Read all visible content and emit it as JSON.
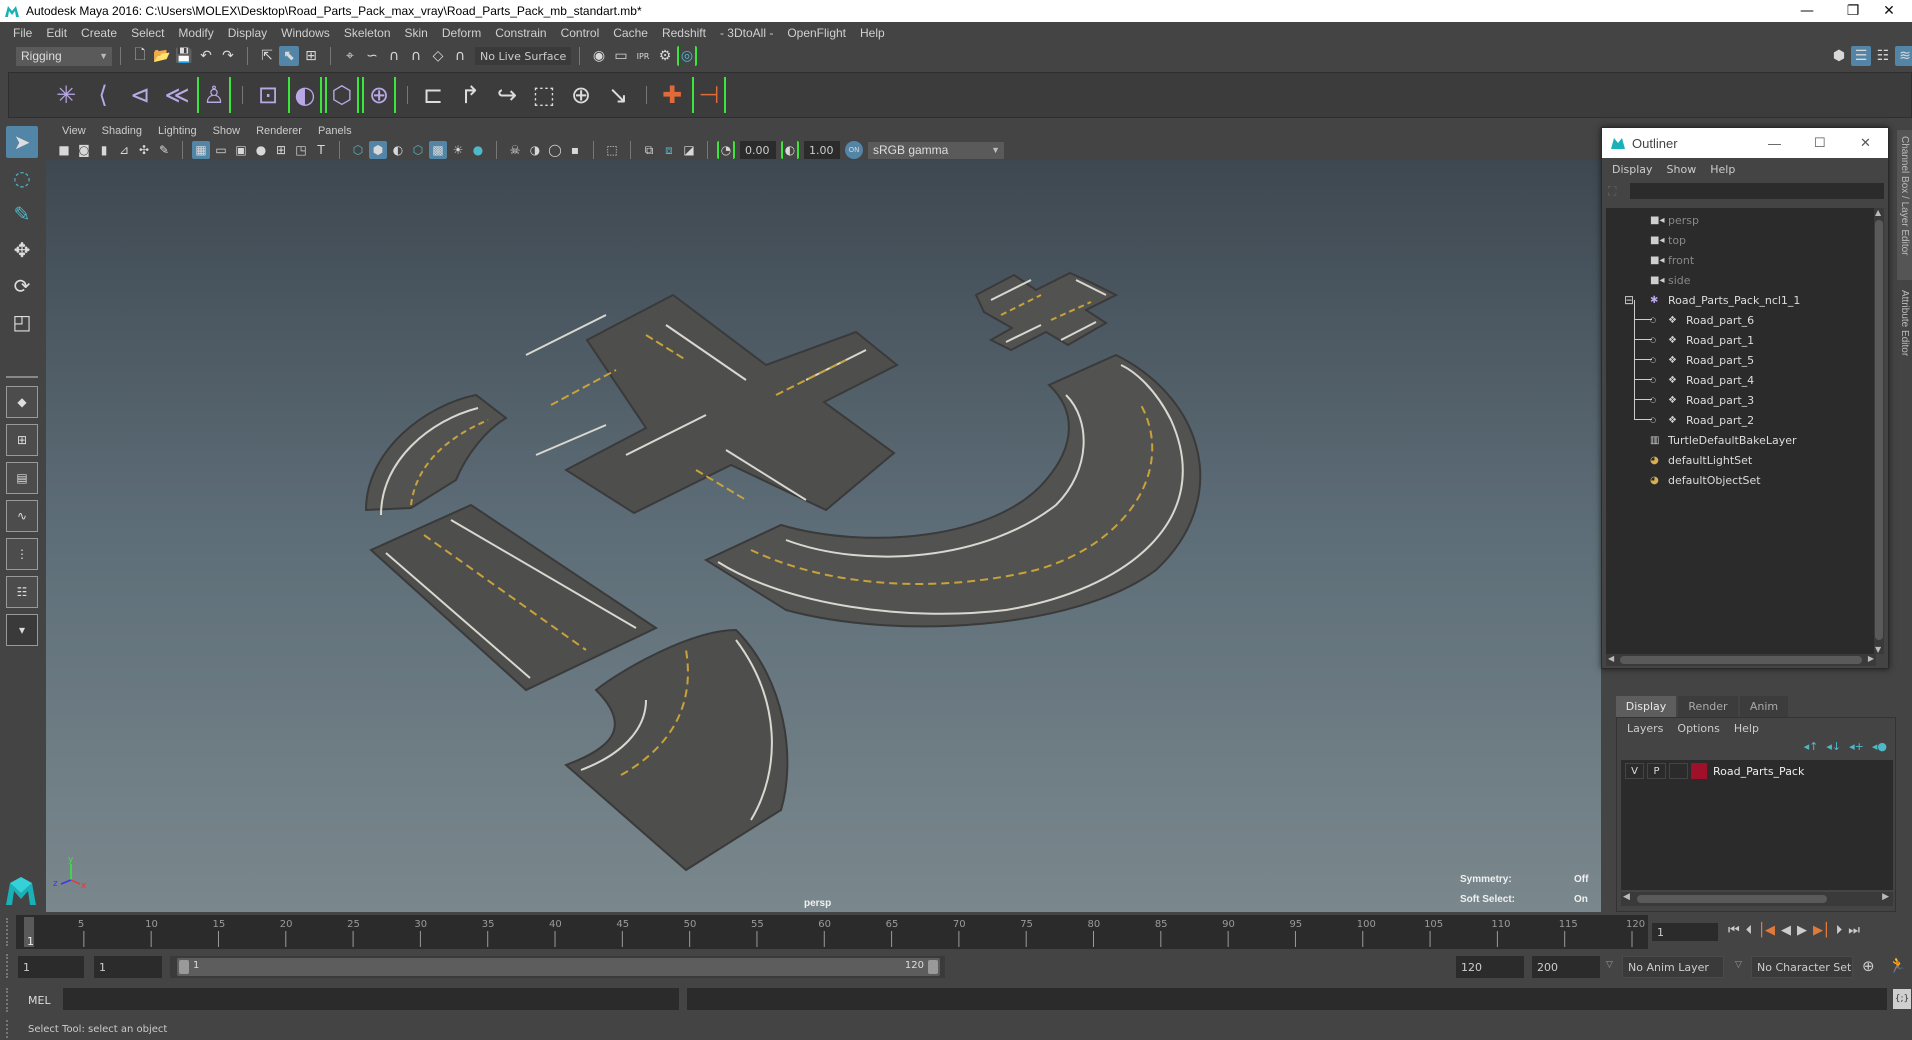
{
  "window": {
    "title": "Autodesk Maya 2016: C:\\Users\\MOLEX\\Desktop\\Road_Parts_Pack_max_vray\\Road_Parts_Pack_mb_standart.mb*",
    "minimize": "—",
    "restore": "❐",
    "close": "✕"
  },
  "menubar": [
    "File",
    "Edit",
    "Create",
    "Select",
    "Modify",
    "Display",
    "Windows",
    "Skeleton",
    "Skin",
    "Deform",
    "Constrain",
    "Control",
    "Cache",
    "Redshift",
    "- 3DtoAll -",
    "OpenFlight",
    "Help"
  ],
  "statusline": {
    "menuset": "Rigging",
    "live_surface": "No Live Surface"
  },
  "panel": {
    "menus": [
      "View",
      "Shading",
      "Lighting",
      "Show",
      "Renderer",
      "Panels"
    ],
    "exposure": "0.00",
    "gamma": "1.00",
    "color_space": "sRGB gamma",
    "color_mgmt_toggle": "ON"
  },
  "viewport": {
    "camera_label": "persp",
    "hud": [
      {
        "label": "Symmetry:",
        "value": "Off"
      },
      {
        "label": "Soft Select:",
        "value": "On"
      }
    ],
    "axis": {
      "x": "x",
      "y": "y",
      "z": "z"
    }
  },
  "outliner": {
    "title": "Outliner",
    "menus": [
      "Display",
      "Show",
      "Help"
    ],
    "search_value": "",
    "items": [
      {
        "label": "persp",
        "icon": "camera-icon",
        "dim": true,
        "depth": 0
      },
      {
        "label": "top",
        "icon": "camera-icon",
        "dim": true,
        "depth": 0
      },
      {
        "label": "front",
        "icon": "camera-icon",
        "dim": true,
        "depth": 0
      },
      {
        "label": "side",
        "icon": "camera-icon",
        "dim": true,
        "depth": 0
      },
      {
        "label": "Road_Parts_Pack_ncl1_1",
        "icon": "group-icon",
        "dim": false,
        "depth": 0,
        "expanded": true
      },
      {
        "label": "Road_part_6",
        "icon": "mesh-icon",
        "dim": false,
        "depth": 1
      },
      {
        "label": "Road_part_1",
        "icon": "mesh-icon",
        "dim": false,
        "depth": 1
      },
      {
        "label": "Road_part_5",
        "icon": "mesh-icon",
        "dim": false,
        "depth": 1
      },
      {
        "label": "Road_part_4",
        "icon": "mesh-icon",
        "dim": false,
        "depth": 1
      },
      {
        "label": "Road_part_3",
        "icon": "mesh-icon",
        "dim": false,
        "depth": 1
      },
      {
        "label": "Road_part_2",
        "icon": "mesh-icon",
        "dim": false,
        "depth": 1
      },
      {
        "label": "TurtleDefaultBakeLayer",
        "icon": "bake-layer-icon",
        "dim": false,
        "depth": 0
      },
      {
        "label": "defaultLightSet",
        "icon": "set-icon",
        "dim": false,
        "depth": 0
      },
      {
        "label": "defaultObjectSet",
        "icon": "set-icon",
        "dim": false,
        "depth": 0
      }
    ]
  },
  "side_tabs": [
    "Channel Box / Layer Editor",
    "Attribute Editor"
  ],
  "layer_editor": {
    "tabs": [
      {
        "label": "Display",
        "active": true
      },
      {
        "label": "Render",
        "active": false
      },
      {
        "label": "Anim",
        "active": false
      }
    ],
    "menus": [
      "Layers",
      "Options",
      "Help"
    ],
    "layers": [
      {
        "visible": "V",
        "playback": "P",
        "name": "Road_Parts_Pack",
        "color": "#a0102a"
      }
    ]
  },
  "timeline": {
    "ticks": [
      5,
      10,
      15,
      20,
      25,
      30,
      35,
      40,
      45,
      50,
      55,
      60,
      65,
      70,
      75,
      80,
      85,
      90,
      95,
      100,
      105,
      110,
      115,
      120
    ],
    "min": 1,
    "max": 120,
    "current_frame": "1",
    "current_frame_field": "1"
  },
  "range": {
    "start_time": "1",
    "playback_start": "1",
    "slider_start": "1",
    "slider_end": "120",
    "playback_end": "120",
    "end_time": "200",
    "anim_layer": "No Anim Layer",
    "character_set": "No Character Set"
  },
  "command_line": {
    "label": "MEL",
    "value": ""
  },
  "help_line": "Select Tool: select an object",
  "colors": {
    "accent": "#5285a6",
    "highlight_green": "#3ae63a",
    "key_orange": "#e07a3a",
    "layer_color": "#a0102a"
  }
}
